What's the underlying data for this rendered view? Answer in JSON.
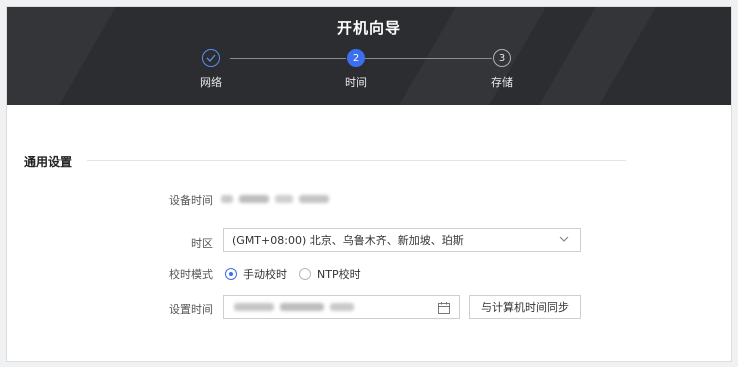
{
  "wizard": {
    "title": "开机向导",
    "steps": [
      {
        "number": "",
        "label": "网络",
        "state": "done"
      },
      {
        "number": "2",
        "label": "时间",
        "state": "active"
      },
      {
        "number": "3",
        "label": "存储",
        "state": "pending"
      }
    ]
  },
  "section": {
    "title": "通用设置"
  },
  "form": {
    "device_time_label": "设备时间",
    "timezone_label": "时区",
    "timezone_value": "(GMT+08:00) 北京、乌鲁木齐、新加坡、珀斯",
    "sync_mode_label": "校时模式",
    "sync_options": [
      {
        "label": "手动校时",
        "selected": true
      },
      {
        "label": "NTP校时",
        "selected": false
      }
    ],
    "set_time_label": "设置时间",
    "sync_button_label": "与计算机时间同步"
  },
  "colors": {
    "banner": "#2c2d30",
    "accent": "#3c6ef0",
    "border": "#cfcfcf"
  },
  "icons": {
    "step1": "check-icon",
    "timezone_dropdown": "chevron-down-icon",
    "date_picker": "calendar-icon"
  }
}
